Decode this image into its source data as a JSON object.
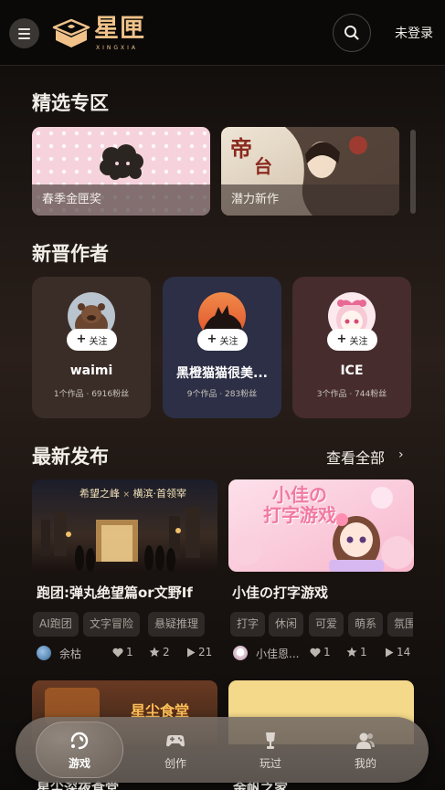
{
  "header": {
    "logo_cn": "星匣",
    "logo_en": "XINGXIA",
    "login": "未登录",
    "icons": {
      "menu": "hamburger-icon",
      "search": "search-icon"
    }
  },
  "featured": {
    "title": "精选专区",
    "items": [
      {
        "label": "春季金匣奖"
      },
      {
        "label": "潜力新作"
      }
    ]
  },
  "authors": {
    "title": "新晋作者",
    "follow_label": "关注",
    "items": [
      {
        "name": "waimi",
        "stats": "1个作品 · 6916粉丝",
        "card_color": "#3a2d27"
      },
      {
        "name": "黑橙猫猫很美...",
        "stats": "9个作品 · 283粉丝",
        "card_color": "#2c2f45"
      },
      {
        "name": "ICE",
        "stats": "3个作品 · 744粉丝",
        "card_color": "#462c2d"
      }
    ]
  },
  "latest": {
    "title": "最新发布",
    "view_all": "查看全部",
    "items": [
      {
        "cover_text_a": "希望之峰",
        "cover_text_x": "×",
        "cover_text_b": "横滨·首领宰",
        "title": "跑团:弹丸绝望篇or文野If",
        "tags": [
          "AI跑团",
          "文字冒险",
          "悬疑推理"
        ],
        "author": "余枯",
        "likes": "1",
        "favorites": "2",
        "plays": "21"
      },
      {
        "cover_text_a": "小佳の",
        "cover_text_b": "打字游戏",
        "title": "小佳の打字游戏",
        "tags": [
          "打字",
          "休闲",
          "可爱",
          "萌系",
          "氛围"
        ],
        "author": "小佳恩...",
        "likes": "1",
        "favorites": "1",
        "plays": "14"
      }
    ],
    "partial_items": [
      {
        "cover_text": "星尘食堂",
        "title": "星尘深夜食堂"
      },
      {
        "title": "金帆之家"
      }
    ]
  },
  "nav": {
    "active": "游戏",
    "items": [
      {
        "label": "游戏",
        "icon": "game-icon"
      },
      {
        "label": "创作",
        "icon": "gamepad-icon"
      },
      {
        "label": "玩过",
        "icon": "trophy-icon"
      },
      {
        "label": "我的",
        "icon": "user-icon"
      }
    ]
  },
  "colors": {
    "accent_gold": "#f0c28a",
    "background": "#0b0908",
    "card_dark": "#3a2d27"
  }
}
